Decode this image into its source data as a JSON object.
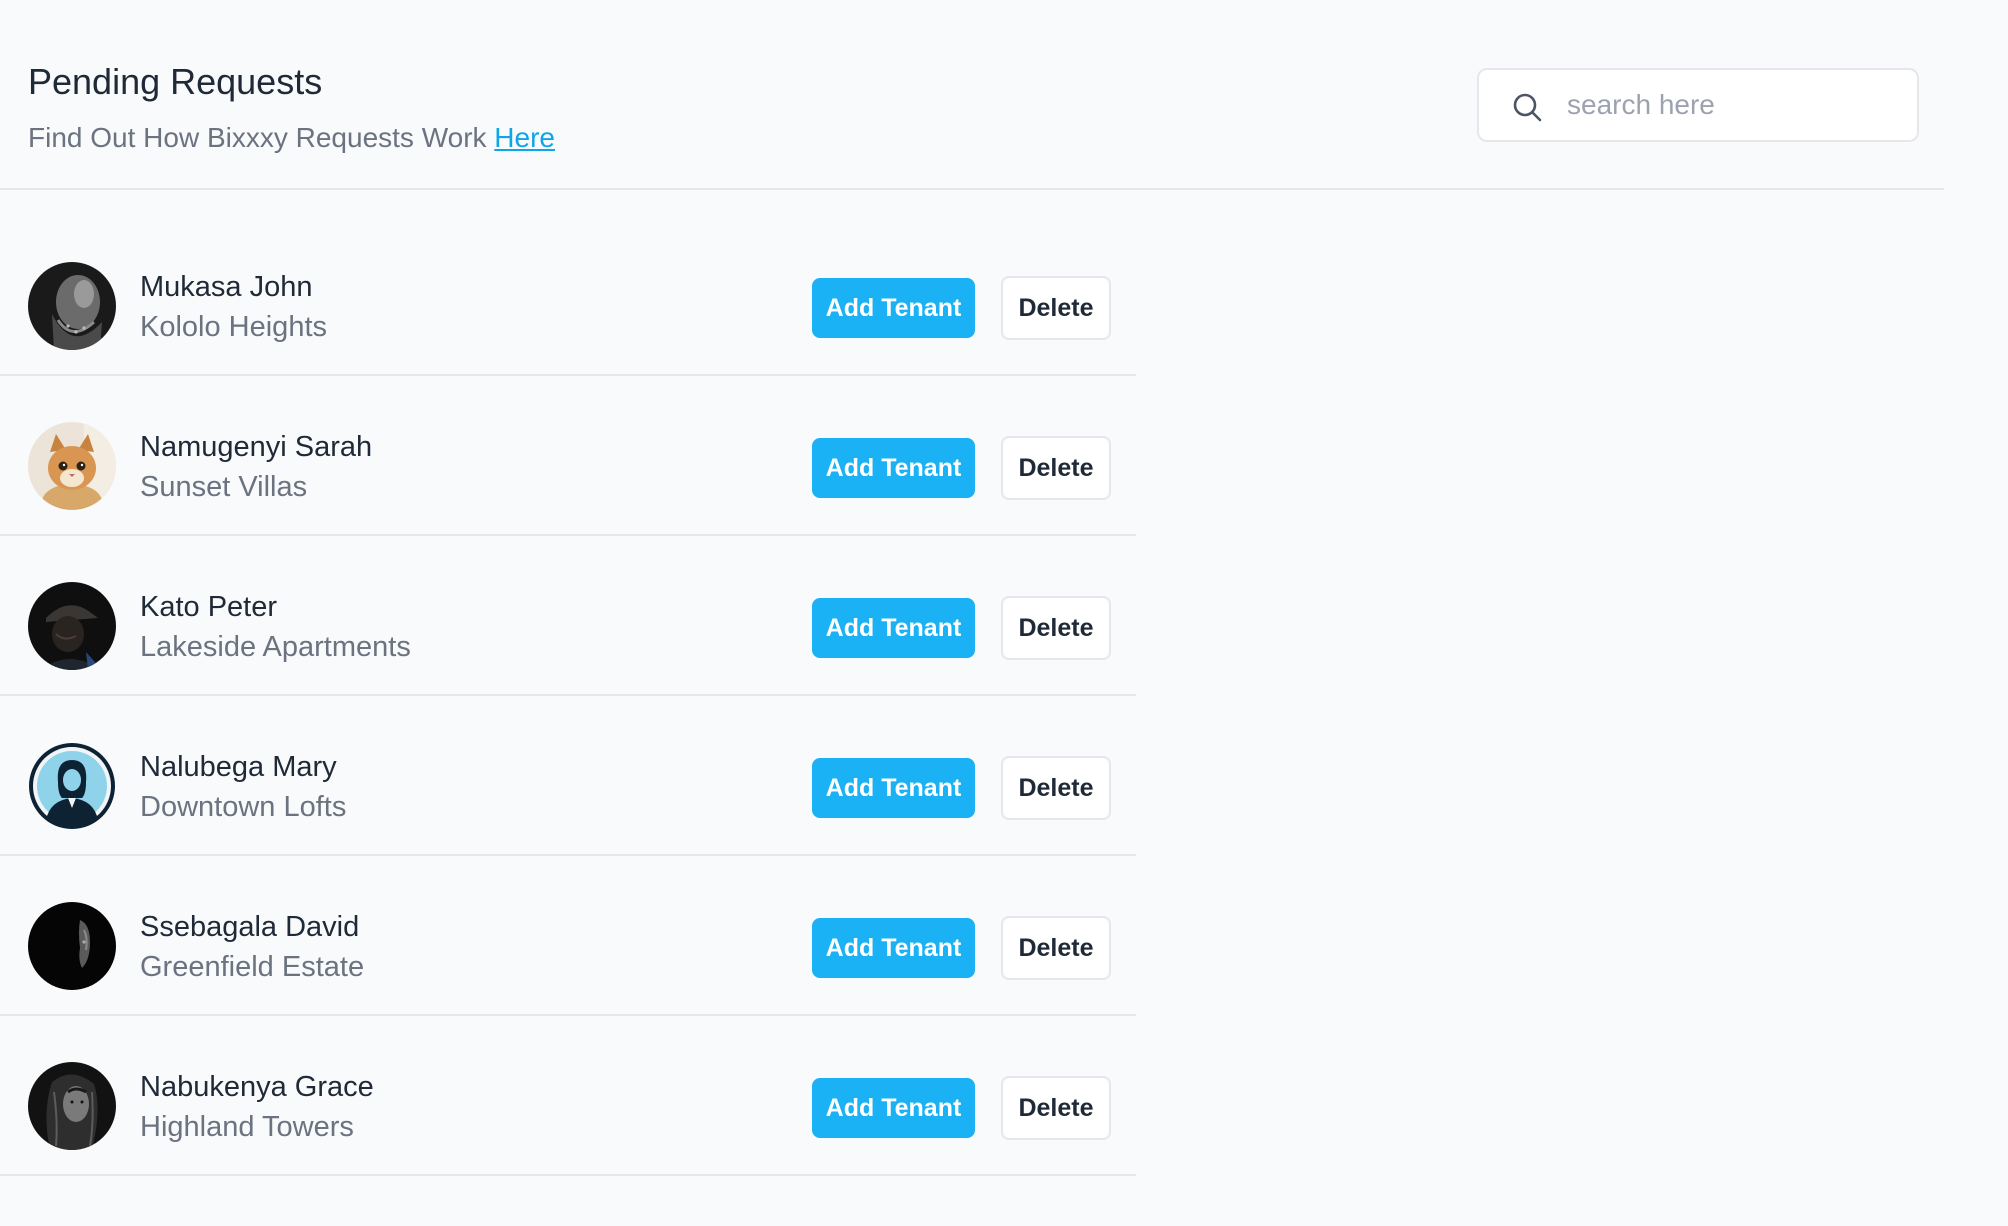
{
  "header": {
    "title": "Pending Requests",
    "subtitle_text": "Find Out How Bixxxy Requests Work ",
    "subtitle_link": "Here"
  },
  "search": {
    "placeholder": "search here",
    "value": ""
  },
  "buttons": {
    "add_label": "Add Tenant",
    "delete_label": "Delete"
  },
  "colors": {
    "primary": "#1ab2f5",
    "link": "#0ea5e9",
    "background": "#f9fafb",
    "muted_text": "#6b7280"
  },
  "requests": [
    {
      "name": "Mukasa John",
      "property": "Kololo Heights",
      "avatar": "bearded-man-photo"
    },
    {
      "name": "Namugenyi Sarah",
      "property": "Sunset Villas",
      "avatar": "kitten-photo"
    },
    {
      "name": "Kato Peter",
      "property": "Lakeside Apartments",
      "avatar": "man-in-cap-photo"
    },
    {
      "name": "Nalubega Mary",
      "property": "Downtown Lofts",
      "avatar": "female-silhouette-icon"
    },
    {
      "name": "Ssebagala David",
      "property": "Greenfield Estate",
      "avatar": "dark-profile-photo"
    },
    {
      "name": "Nabukenya Grace",
      "property": "Highland Towers",
      "avatar": "woman-portrait-photo"
    }
  ]
}
